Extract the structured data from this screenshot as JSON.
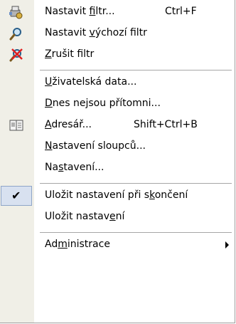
{
  "menu": {
    "items": [
      {
        "pre": "Nastavit ",
        "u": "f",
        "post": "iltr...",
        "shortcut": "Ctrl+F",
        "icon": "filter-set-icon"
      },
      {
        "pre": "Nastavit ",
        "u": "v",
        "post": "ýchozí filtr",
        "shortcut": "",
        "icon": "search-magnifier-icon"
      },
      {
        "pre": "",
        "u": "Z",
        "post": "rušit filtr",
        "shortcut": "",
        "icon": "cancel-filter-icon"
      },
      {
        "pre": "",
        "u": "U",
        "post": "živatelská data...",
        "shortcut": "",
        "icon": ""
      },
      {
        "pre": "",
        "u": "D",
        "post": "nes nejsou přítomni...",
        "shortcut": "",
        "icon": ""
      },
      {
        "pre": "",
        "u": "A",
        "post": "dresář...",
        "shortcut": "Shift+Ctrl+B",
        "icon": "address-book-icon"
      },
      {
        "pre": "",
        "u": "N",
        "post": "astavení sloupců...",
        "shortcut": "",
        "icon": ""
      },
      {
        "pre": "Na",
        "u": "s",
        "post": "tavení...",
        "shortcut": "",
        "icon": ""
      },
      {
        "pre": "Uložit nastavení při s",
        "u": "k",
        "post": "ončení",
        "shortcut": "",
        "icon": "checkmark-icon"
      },
      {
        "pre": "Uložit nastav",
        "u": "e",
        "post": "ní",
        "shortcut": "",
        "icon": ""
      },
      {
        "pre": "Ad",
        "u": "m",
        "post": "inistrace",
        "shortcut": "",
        "icon": "submenu-arrow-icon"
      }
    ]
  },
  "colors": {
    "gutter": "#f0efe7",
    "separator": "#a6a6a6",
    "check_highlight": "#d8e1f0",
    "check_border": "#8fa5c8"
  }
}
